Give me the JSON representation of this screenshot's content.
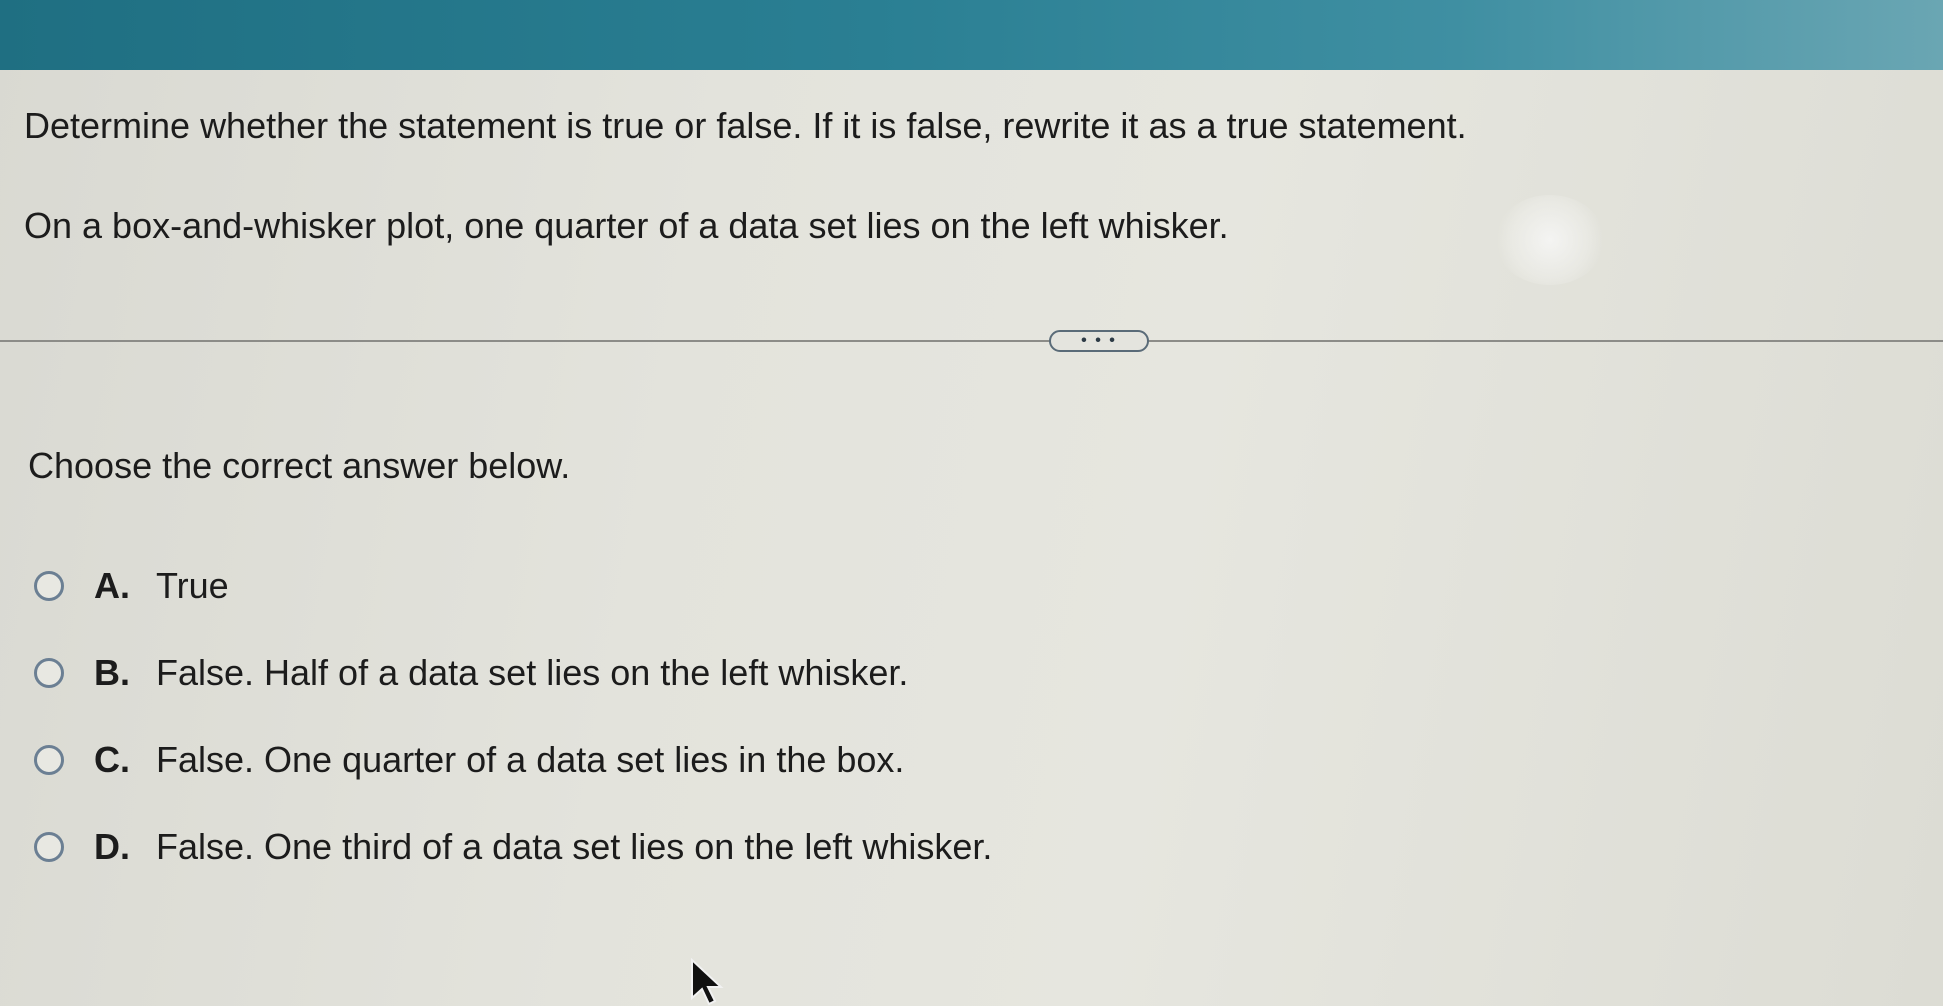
{
  "question": {
    "prompt": "Determine whether the statement is true or false. If it is false, rewrite it as a true statement.",
    "statement": "On a box-and-whisker plot, one quarter of a data set lies on the left whisker."
  },
  "more_button": {
    "label": "• • •"
  },
  "answer_section": {
    "instruction": "Choose the correct answer below.",
    "options": [
      {
        "letter": "A.",
        "text": "True"
      },
      {
        "letter": "B.",
        "text": "False. Half of a data set lies on the left whisker."
      },
      {
        "letter": "C.",
        "text": "False. One quarter of a data set lies in the box."
      },
      {
        "letter": "D.",
        "text": "False. One third of a data set lies on the left whisker."
      }
    ]
  },
  "colors": {
    "top_bar": "#2a7f93",
    "radio_border": "#6b7f93",
    "background": "#e3e3dc"
  },
  "icons": {
    "cursor": "arrow-cursor-icon",
    "more": "ellipsis-icon"
  }
}
